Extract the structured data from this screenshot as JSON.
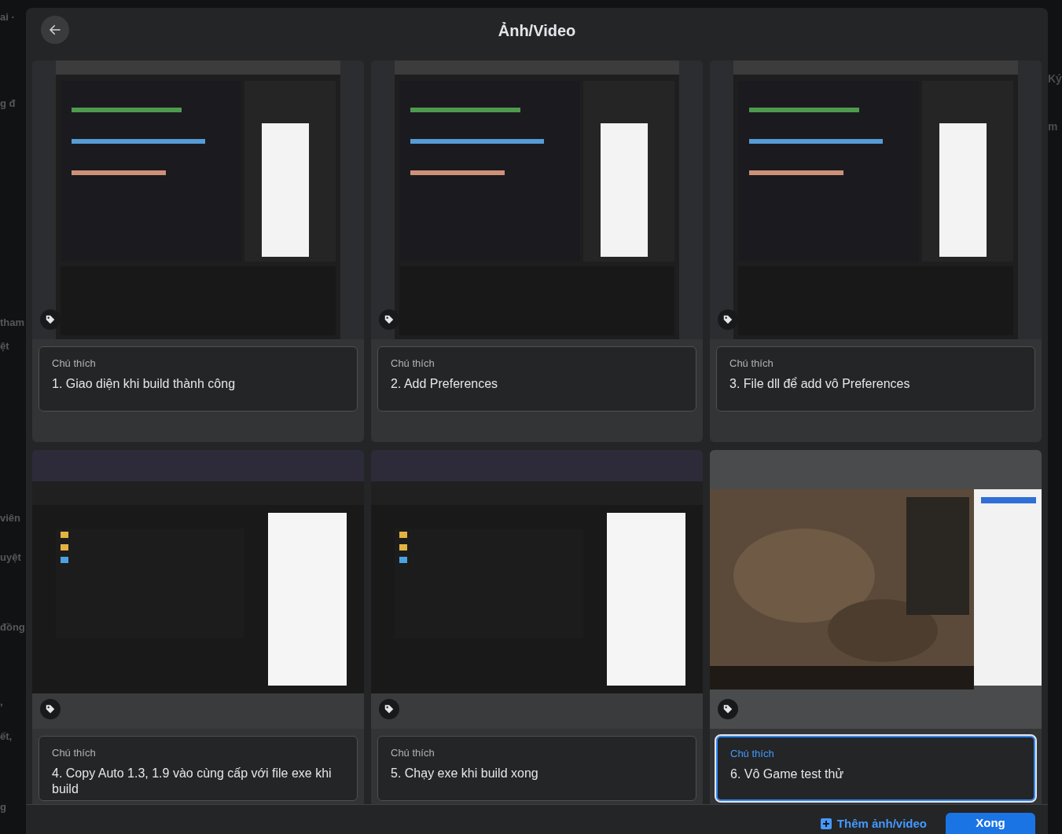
{
  "background": {
    "left_fragments": [
      "ai ·",
      "g đ",
      "tham",
      "ệt",
      "viên",
      "uyệt",
      "đồng",
      ",",
      "ết,",
      "g"
    ],
    "right_fragments": [
      "Ký",
      "m"
    ]
  },
  "dialog": {
    "title": "Ảnh/Video"
  },
  "photos": [
    {
      "kind": "ide",
      "caption_label": "Chú thích",
      "caption": "1. Giao diện khi build thành công",
      "selected": false
    },
    {
      "kind": "ide",
      "caption_label": "Chú thích",
      "caption": "2. Add Preferences",
      "selected": false
    },
    {
      "kind": "ide",
      "caption_label": "Chú thích",
      "caption": "3. File dll để add vô Preferences",
      "selected": false
    },
    {
      "kind": "explorer",
      "caption_label": "Chú thích",
      "caption": "4. Copy Auto 1.3, 1.9 vào cùng cấp với file exe khi build",
      "selected": false
    },
    {
      "kind": "explorer",
      "caption_label": "Chú thích",
      "caption": "5. Chạy exe khi build xong",
      "selected": false
    },
    {
      "kind": "game",
      "caption_label": "Chú thích",
      "caption": "6. Vô Game test thử",
      "selected": true
    }
  ],
  "footer": {
    "add_link": "Thêm ảnh/video",
    "done_button": "Xong"
  }
}
